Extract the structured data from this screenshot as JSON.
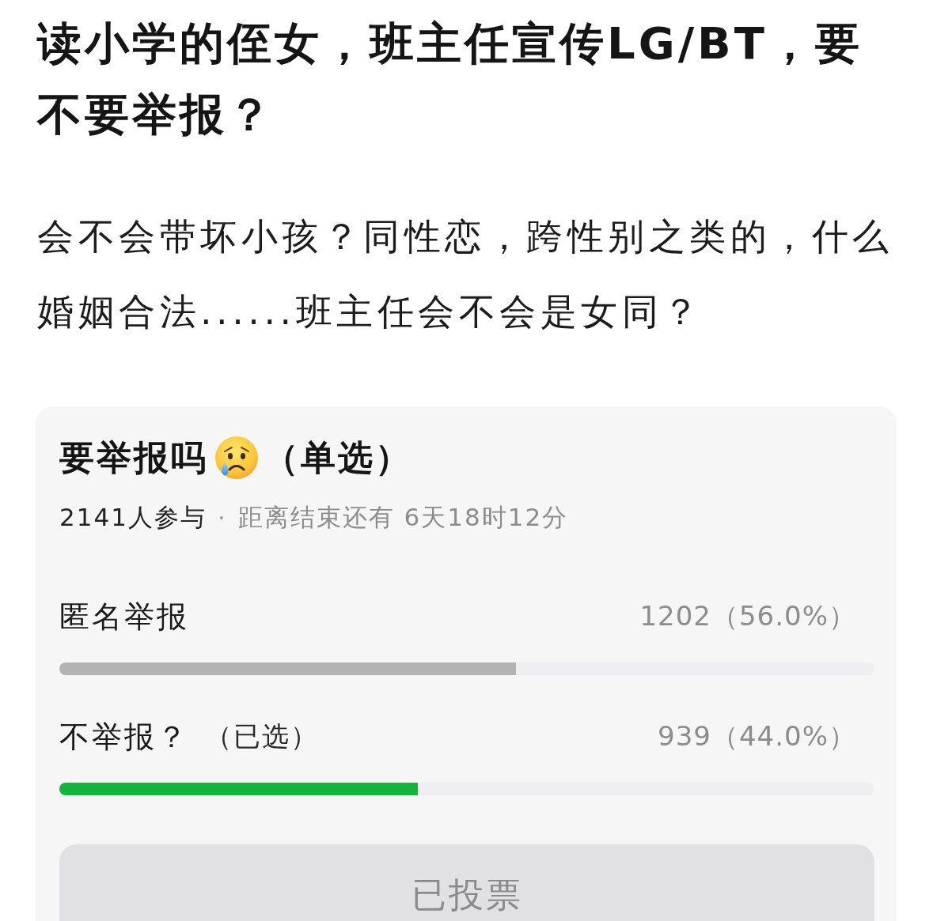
{
  "post": {
    "title": "读小学的侄女，班主任宣传LG/BT，要不要举报？",
    "body": "会不会带坏小孩？同性恋，跨性别之类的，什么婚姻合法......班主任会不会是女同？"
  },
  "poll": {
    "title": "要举报吗",
    "mode": "（单选）",
    "participants": "2141人参与",
    "separator": "·",
    "deadline": "距离结束还有 6天18时12分",
    "options": [
      {
        "label": "匿名举报",
        "count": "1202（56.0%）",
        "level": 0.56,
        "selected": false
      },
      {
        "label": "不举报？",
        "note": "（已选）",
        "count": "939（44.0%）",
        "level": 0.44,
        "selected": true
      }
    ],
    "button": {
      "label": "已投票",
      "disabled": true
    }
  }
}
